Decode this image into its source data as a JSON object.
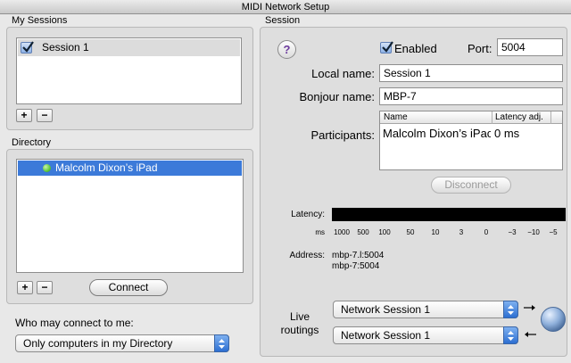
{
  "window": {
    "title": "MIDI Network Setup"
  },
  "my_sessions": {
    "heading": "My Sessions",
    "items": [
      {
        "label": "Session 1",
        "checked": true
      }
    ],
    "add_label": "+",
    "remove_label": "−"
  },
  "directory": {
    "heading": "Directory",
    "items": [
      {
        "label": "Malcolm Dixon’s iPad",
        "status_color": "#5cc93a"
      }
    ],
    "add_label": "+",
    "remove_label": "−",
    "connect_label": "Connect"
  },
  "who_may_connect": {
    "label": "Who may connect to me:",
    "selected": "Only computers in my Directory"
  },
  "session": {
    "heading": "Session",
    "help_label": "?",
    "enabled_label": "Enabled",
    "enabled": true,
    "port_label": "Port:",
    "port_value": "5004",
    "local_name_label": "Local name:",
    "local_name_value": "Session 1",
    "bonjour_name_label": "Bonjour name:",
    "bonjour_name_value": "MBP-7",
    "participants_label": "Participants:",
    "participants_columns": [
      "Name",
      "Latency adj."
    ],
    "participants_rows": [
      {
        "name": "Malcolm Dixon’s iPac",
        "latency": "0 ms"
      }
    ],
    "disconnect_label": "Disconnect",
    "latency_label": "Latency:",
    "latency_unit": "ms",
    "latency_ticks": [
      "1000",
      "500",
      "100",
      "50",
      "10",
      "3",
      "0",
      "−3",
      "−10",
      "−5"
    ],
    "address_label": "Address:",
    "address_lines": [
      "mbp-7.l:5004",
      "mbp-7:5004"
    ],
    "live_routings_label_1": "Live",
    "live_routings_label_2": "routings",
    "routing_in": "Network Session 1",
    "routing_out": "Network Session 1"
  },
  "colors": {
    "accent": "#3875d7",
    "selection": "#3c7ad9",
    "status_green": "#5cc93a",
    "meter": "#000000"
  }
}
